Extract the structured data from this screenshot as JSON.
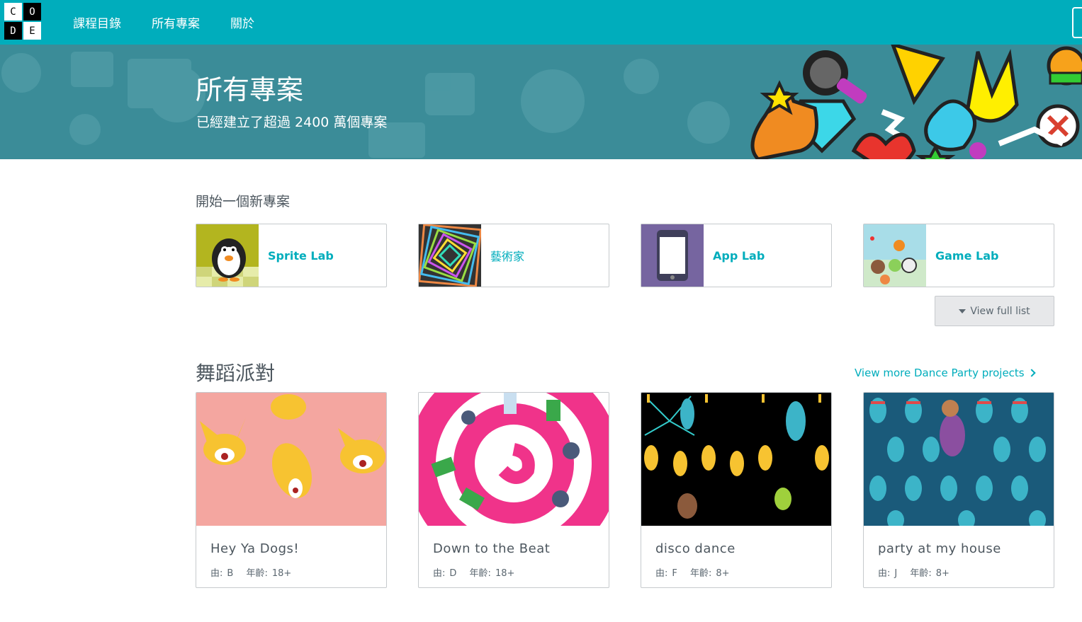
{
  "logo": {
    "letters": [
      "C",
      "O",
      "D",
      "E"
    ]
  },
  "nav": {
    "items": [
      "課程目錄",
      "所有專案",
      "關於"
    ]
  },
  "hero": {
    "title": "所有專案",
    "subtitle": "已經建立了超過 2400 萬個專案"
  },
  "start": {
    "label": "開始一個新專案",
    "cards": [
      {
        "label": "Sprite Lab",
        "icon": "penguin-icon"
      },
      {
        "label": "藝術家",
        "icon": "spiral-art-icon"
      },
      {
        "label": "App Lab",
        "icon": "phone-icon"
      },
      {
        "label": "Game Lab",
        "icon": "characters-icon"
      }
    ],
    "view_full": "View full list"
  },
  "dance": {
    "title": "舞蹈派對",
    "view_more": "View more Dance Party projects",
    "projects": [
      {
        "name": "Hey Ya Dogs!",
        "by_label": "由:",
        "author": "B",
        "age_label": "年齡:",
        "age": "18+",
        "bg": "#f4a6a0"
      },
      {
        "name": "Down to the Beat",
        "by_label": "由:",
        "author": "D",
        "age_label": "年齡:",
        "age": "18+",
        "bg": "#ffffff"
      },
      {
        "name": "disco dance",
        "by_label": "由:",
        "author": "F",
        "age_label": "年齡:",
        "age": "8+",
        "bg": "#000000"
      },
      {
        "name": "party at my house",
        "by_label": "由:",
        "author": "J",
        "age_label": "年齡:",
        "age": "8+",
        "bg": "#1a5a7a"
      }
    ]
  },
  "colors": {
    "brand": "#00adbc",
    "hero_bg": "#3b8c98",
    "text": "#4d575f"
  }
}
